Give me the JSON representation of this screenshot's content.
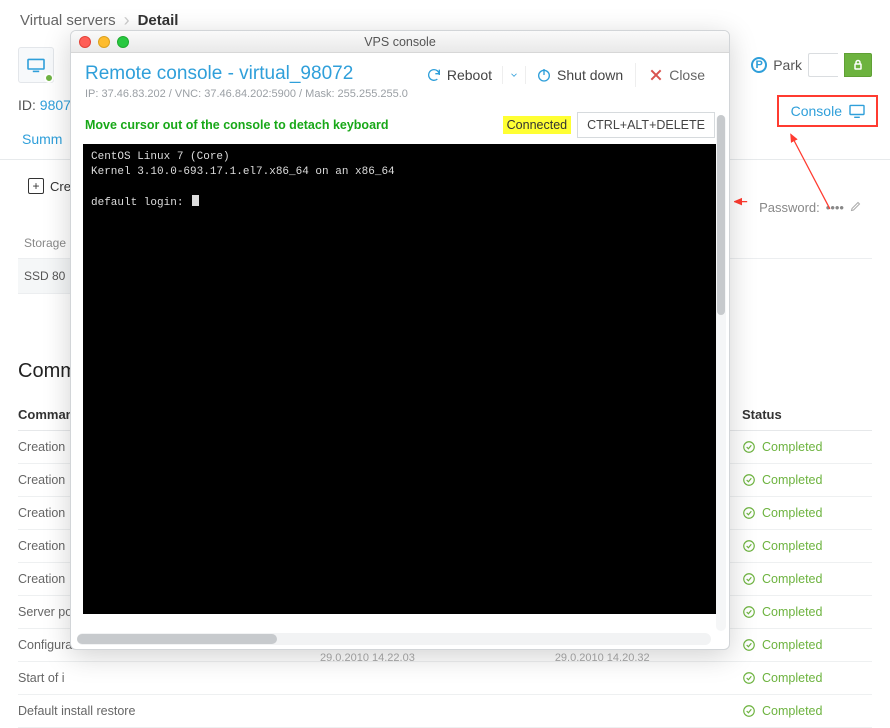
{
  "breadcrumb": {
    "root": "Virtual servers",
    "leaf": "Detail"
  },
  "header": {
    "park_label": "Park",
    "id_prefix": "ID:",
    "id_value": "9807",
    "console_btn": "Console"
  },
  "tabs": {
    "summary": "Summ"
  },
  "sidebar": {
    "create": "Cre",
    "storage_head": "Storage",
    "storage_row": "SSD 80"
  },
  "password": {
    "label": "Password:",
    "mask": "••••"
  },
  "commands": {
    "title": "Comma",
    "col_left": "Comman",
    "col_right": "Status",
    "rows": [
      "Creation",
      "Creation",
      "Creation",
      "Creation",
      "Creation",
      "Server po",
      "Configura",
      "Start of i",
      "Default install restore"
    ],
    "status_label": "Completed"
  },
  "timestamps": {
    "a": "29.0.2010 14.22.03",
    "b": "29.0.2010 14.20.32"
  },
  "modal": {
    "window_title": "VPS console",
    "title": "Remote console - virtual_98072",
    "meta": "IP: 37.46.83.202 / VNC: 37.46.84.202:5900 / Mask: 255.255.255.0",
    "reboot": "Reboot",
    "shutdown": "Shut down",
    "close": "Close",
    "hint": "Move cursor out of the console to detach keyboard",
    "connected": "Connected",
    "cad": "CTRL+ALT+DELETE",
    "terminal": "CentOS Linux 7 (Core)\nKernel 3.10.0-693.17.1.el7.x86_64 on an x86_64\n\ndefault login: "
  }
}
